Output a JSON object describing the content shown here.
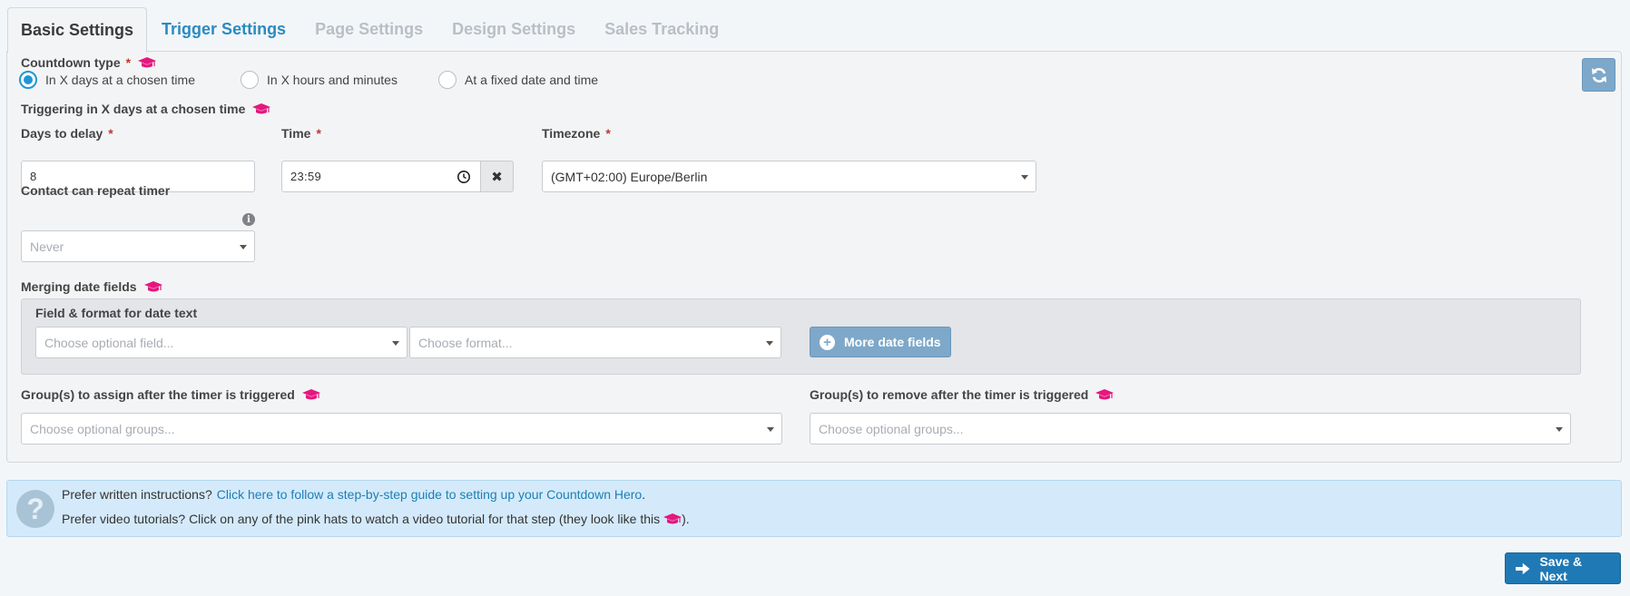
{
  "tabs": [
    {
      "label": "Basic Settings",
      "state": "active"
    },
    {
      "label": "Trigger Settings",
      "state": "secondary"
    },
    {
      "label": "Page Settings",
      "state": "disabled"
    },
    {
      "label": "Design Settings",
      "state": "disabled"
    },
    {
      "label": "Sales Tracking",
      "state": "disabled"
    }
  ],
  "required_marker": "*",
  "countdown_type": {
    "label": "Countdown type",
    "options": [
      {
        "label": "In X days at a chosen time",
        "checked": true
      },
      {
        "label": "In X hours and minutes",
        "checked": false
      },
      {
        "label": "At a fixed date and time",
        "checked": false
      }
    ]
  },
  "triggering": {
    "label": "Triggering in X days at a chosen time"
  },
  "days_delay": {
    "label": "Days to delay",
    "value": "8"
  },
  "time": {
    "label": "Time",
    "value": "23:59",
    "clear_glyph": "✖"
  },
  "timezone": {
    "label": "Timezone",
    "value": "(GMT+02:00) Europe/Berlin"
  },
  "repeat": {
    "label": "Contact can repeat timer",
    "value": "Never",
    "info_glyph": "i"
  },
  "merging": {
    "label": "Merging date fields",
    "field_format_label": "Field & format for date text",
    "field_placeholder": "Choose optional field...",
    "format_placeholder": "Choose format...",
    "more_button": "More date fields",
    "plus_glyph": "+"
  },
  "groups_assign": {
    "label": "Group(s) to assign after the timer is triggered",
    "placeholder": "Choose optional groups..."
  },
  "groups_remove": {
    "label": "Group(s) to remove after the timer is triggered",
    "placeholder": "Choose optional groups..."
  },
  "help": {
    "icon_glyph": "?",
    "line1_prefix": "Prefer written instructions?",
    "line1_link": "Click here to follow a step-by-step guide to setting up your Countdown Hero",
    "line1_suffix": ".",
    "line2_prefix": "Prefer video tutorials? Click on any of the pink hats to watch a video tutorial for that step (they look like this",
    "line2_suffix": ")."
  },
  "save_button": "Save & Next",
  "colors": {
    "hat": "#e5177e",
    "accent": "#2196d3",
    "link": "#1c7fb6",
    "save": "#1f79b5"
  }
}
